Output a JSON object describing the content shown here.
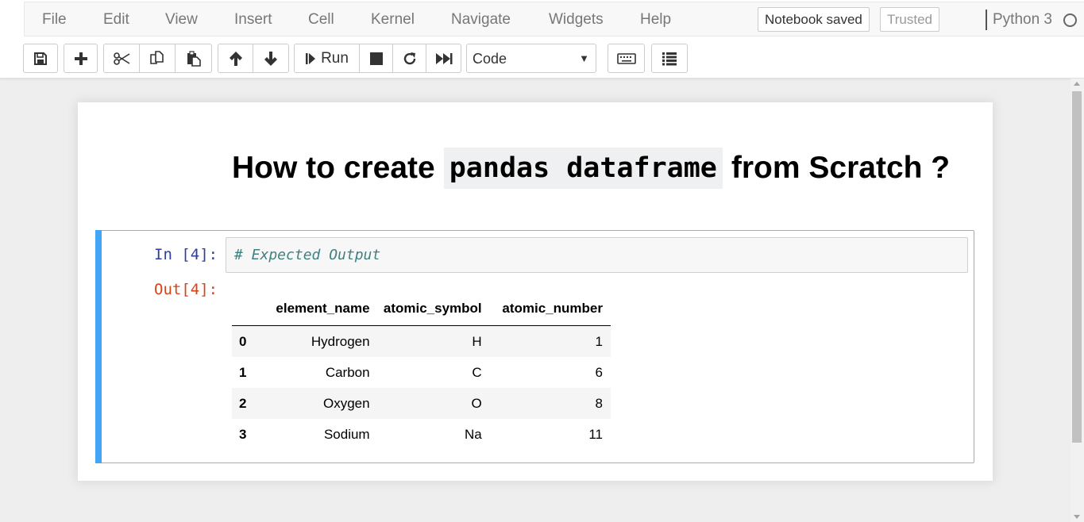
{
  "menu": {
    "items": [
      "File",
      "Edit",
      "View",
      "Insert",
      "Cell",
      "Kernel",
      "Navigate",
      "Widgets",
      "Help"
    ],
    "notebook_status": "Notebook saved",
    "trust_status": "Trusted",
    "kernel_name": "Python 3"
  },
  "toolbar": {
    "run_label": "Run",
    "cell_type": "Code",
    "icons": [
      "save-icon",
      "plus-icon",
      "cut-icon",
      "copy-icon",
      "paste-icon",
      "arrow-up-icon",
      "arrow-down-icon",
      "step-forward-icon",
      "stop-icon",
      "restart-icon",
      "fast-forward-icon",
      "keyboard-icon",
      "list-icon"
    ]
  },
  "markdown": {
    "title_before": "How to create",
    "title_code": "pandas dataframe",
    "title_after": "from Scratch ?"
  },
  "cell": {
    "in_prompt": "In [4]:",
    "out_prompt": "Out[4]:",
    "code": "# Expected Output"
  },
  "dataframe": {
    "columns": [
      "",
      "element_name",
      "atomic_symbol",
      "atomic_number"
    ],
    "rows": [
      [
        "0",
        "Hydrogen",
        "H",
        "1"
      ],
      [
        "1",
        "Carbon",
        "C",
        "6"
      ],
      [
        "2",
        "Oxygen",
        "O",
        "8"
      ],
      [
        "3",
        "Sodium",
        "Na",
        "11"
      ]
    ]
  },
  "colors": {
    "cell_selected_bar": "#42a5f5",
    "in_prompt": "#303f9f",
    "out_prompt": "#d84315",
    "comment": "#408080"
  }
}
